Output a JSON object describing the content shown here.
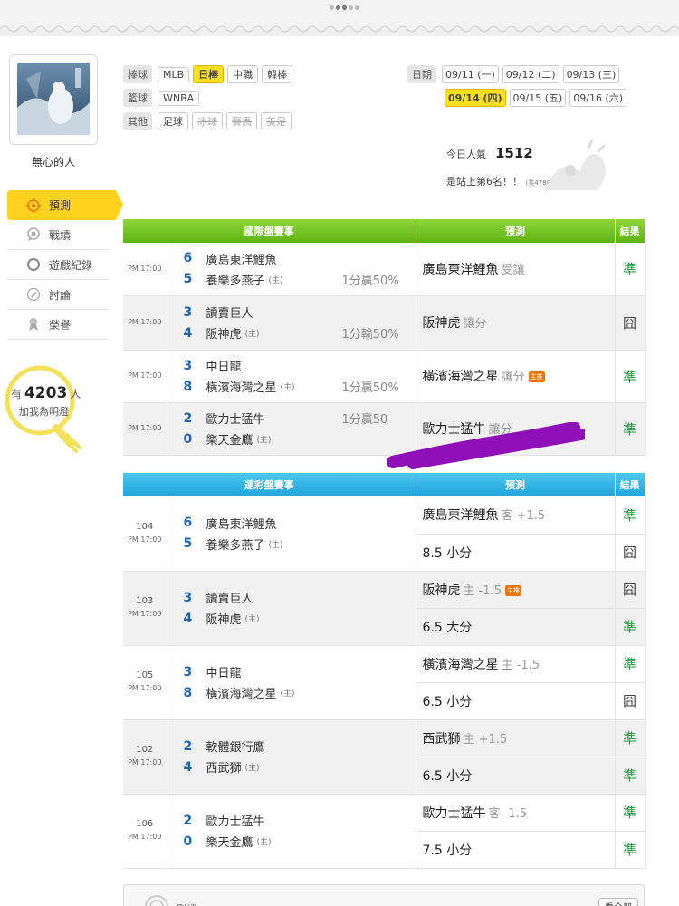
{
  "user": {
    "name": "無心的人"
  },
  "sidebar": {
    "items": [
      {
        "label": "預測",
        "icon": "target-icon"
      },
      {
        "label": "戰績",
        "icon": "chat-bubble-icon"
      },
      {
        "label": "遊戲紀錄",
        "icon": "circle-icon"
      },
      {
        "label": "討論",
        "icon": "pencil-icon"
      },
      {
        "label": "榮譽",
        "icon": "medal-icon"
      }
    ],
    "fans": {
      "prefix": "有",
      "count": "4203",
      "suffix": "人",
      "cta": "加我為明燈"
    }
  },
  "filters": {
    "rows": [
      {
        "label": "棒球",
        "chips": [
          "MLB",
          "日棒",
          "中職",
          "韓棒"
        ]
      },
      {
        "label": "籃球",
        "chips": [
          "WNBA"
        ]
      },
      {
        "label": "其他",
        "chips": [
          "足球",
          "冰球",
          "賽馬",
          "美足"
        ]
      }
    ],
    "dates_label": "日期",
    "dates_row1": [
      "09/11 (一)",
      "09/12 (二)",
      "09/13 (三)"
    ],
    "dates_row2": [
      "09/14 (四)",
      "09/15 (五)",
      "09/16 (六)"
    ]
  },
  "stats": {
    "pop_label": "今日人氣",
    "pop_value": "1512",
    "rank": "是站上第6名！！",
    "rank_note": "(共4780人)"
  },
  "intl": {
    "headers": [
      "國際盤賽事",
      "預測",
      "結果"
    ],
    "rows": [
      {
        "time": "PM 17:00",
        "t1_score": "6",
        "t1": "廣島東洋鯉魚",
        "t2_score": "5",
        "t2": "養樂多燕子",
        "home": "(主)",
        "odds": "1分贏50%",
        "pred": "廣島東洋鯉魚",
        "pred_sub": "受讓",
        "badge": "",
        "result": "準"
      },
      {
        "time": "PM 17:00",
        "t1_score": "3",
        "t1": "讀賣巨人",
        "t2_score": "4",
        "t2": "阪神虎",
        "home": "(主)",
        "odds": "1分輸50%",
        "pred": "阪神虎",
        "pred_sub": "讓分",
        "badge": "",
        "result": "囧"
      },
      {
        "time": "PM 17:00",
        "t1_score": "3",
        "t1": "中日龍",
        "t2_score": "8",
        "t2": "橫濱海灣之星",
        "home": "(主)",
        "odds": "1分贏50%",
        "pred": "橫濱海灣之星",
        "pred_sub": "讓分",
        "badge": "主推",
        "result": "準"
      },
      {
        "time": "PM 17:00",
        "t1_score": "2",
        "t1": "歐力士猛牛",
        "t2_score": "0",
        "t2": "樂天金鷹",
        "home": "(主)",
        "odds": "1分贏50",
        "pred": "歐力士猛牛",
        "pred_sub": "讓分",
        "badge": "",
        "result": "準"
      }
    ]
  },
  "lottery": {
    "headers": [
      "運彩盤賽事",
      "預測",
      "結果"
    ],
    "rows": [
      {
        "no": "104",
        "time": "PM 17:00",
        "t1_score": "6",
        "t1": "廣島東洋鯉魚",
        "t2_score": "5",
        "t2": "養樂多燕子",
        "home": "(主)",
        "p1": "廣島東洋鯉魚",
        "p1_sub": "客 +1.5",
        "p1_badge": "",
        "r1": "準",
        "p2": "8.5 小分",
        "r2": "囧"
      },
      {
        "no": "103",
        "time": "PM 17:00",
        "t1_score": "3",
        "t1": "讀賣巨人",
        "t2_score": "4",
        "t2": "阪神虎",
        "home": "(主)",
        "p1": "阪神虎",
        "p1_sub": "主 -1.5",
        "p1_badge": "主推",
        "r1": "囧",
        "p2": "6.5 大分",
        "r2": "準"
      },
      {
        "no": "105",
        "time": "PM 17:00",
        "t1_score": "3",
        "t1": "中日龍",
        "t2_score": "8",
        "t2": "橫濱海灣之星",
        "home": "(主)",
        "p1": "橫濱海灣之星",
        "p1_sub": "主 -1.5",
        "p1_badge": "",
        "r1": "準",
        "p2": "6.5 小分",
        "r2": "囧"
      },
      {
        "no": "102",
        "time": "PM 17:00",
        "t1_score": "2",
        "t1": "軟體銀行鷹",
        "t2_score": "4",
        "t2": "西武獅",
        "home": "(主)",
        "p1": "西武獅",
        "p1_sub": "主 +1.5",
        "p1_badge": "",
        "r1": "準",
        "p2": "6.5 小分",
        "r2": "準"
      },
      {
        "no": "106",
        "time": "PM 17:00",
        "t1_score": "2",
        "t1": "歐力士猛牛",
        "t2_score": "0",
        "t2": "樂天金鷹",
        "home": "(主)",
        "p1": "歐力士猛牛",
        "p1_sub": "客 -1.5",
        "p1_badge": "",
        "r1": "準",
        "p2": "7.5 小分",
        "r2": "準"
      }
    ]
  },
  "footer": {
    "label": "刪繡",
    "see_all": "看全部"
  },
  "colors": {
    "accent": "#ffd21f",
    "intl_header": "#5fb311",
    "lottery_header": "#1fa4db",
    "win": "#1a9a3a",
    "score": "#1f63b8"
  }
}
